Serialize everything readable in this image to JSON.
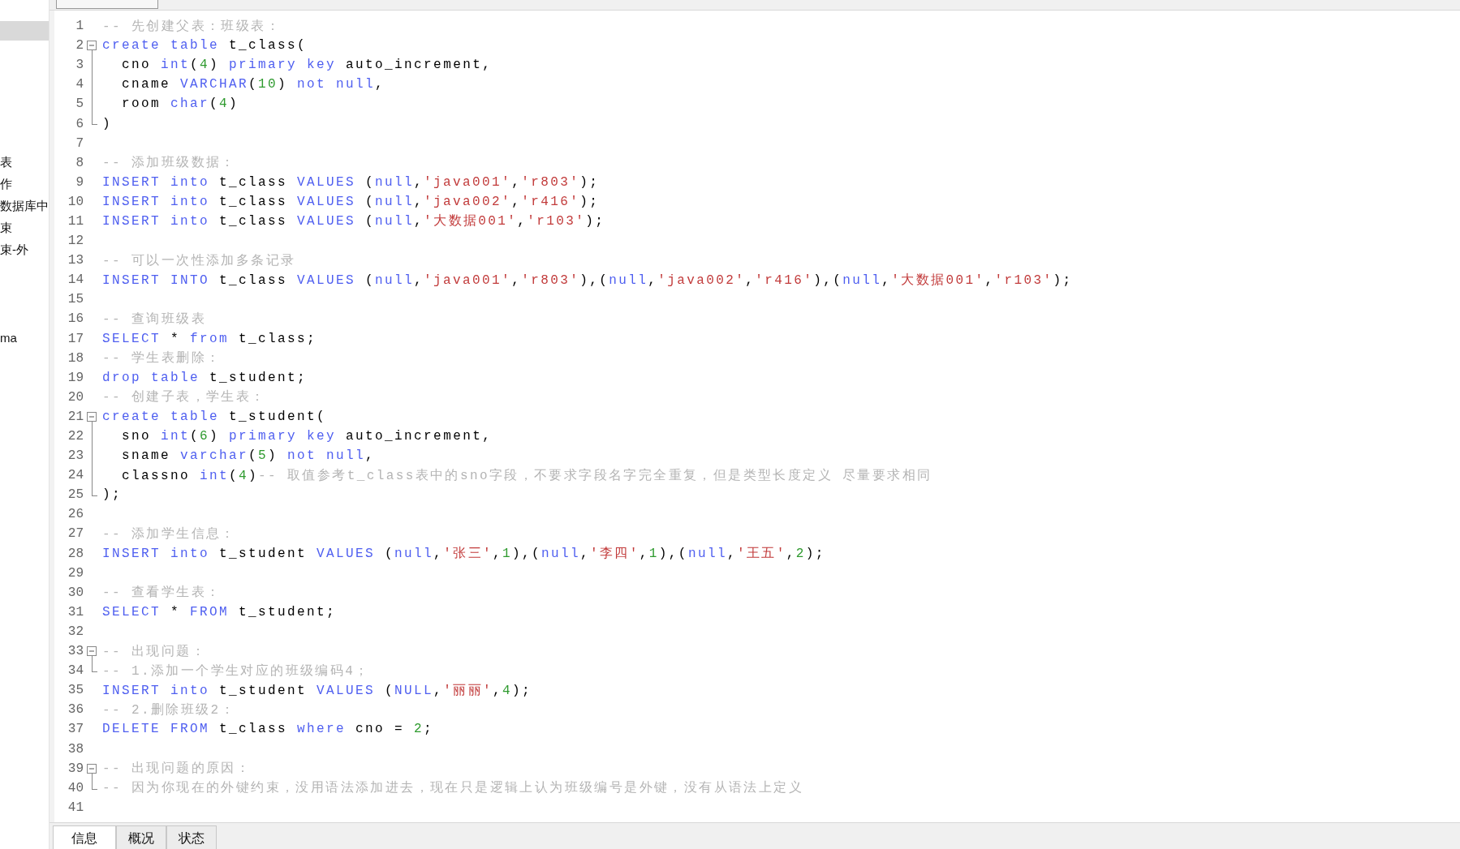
{
  "sidebar": {
    "items": [
      {
        "selected": true
      },
      {
        "label": "表",
        "selected": false
      },
      {
        "label": "作",
        "selected": false
      },
      {
        "label": "数据库中",
        "selected": false
      },
      {
        "label": "束",
        "selected": false
      },
      {
        "label": "束-外",
        "selected": false
      },
      {
        "label": "ma",
        "selected": false
      }
    ]
  },
  "editor": {
    "lines": [
      {
        "no": "1",
        "kind": "plain",
        "tokens": [
          {
            "kind": "cm",
            "t": "-- 先创建父表：班级表："
          }
        ]
      },
      {
        "no": "2",
        "kind": "fold_start",
        "tokens": [
          {
            "kind": "kw",
            "t": "create table"
          },
          {
            "kind": "tx",
            "t": " t_class("
          }
        ]
      },
      {
        "no": "3",
        "kind": "fold_mid",
        "tokens": [
          {
            "kind": "tx",
            "t": "  cno "
          },
          {
            "kind": "kw",
            "t": "int"
          },
          {
            "kind": "tx",
            "t": "("
          },
          {
            "kind": "num",
            "t": "4"
          },
          {
            "kind": "tx",
            "t": ") "
          },
          {
            "kind": "kw",
            "t": "primary key"
          },
          {
            "kind": "tx",
            "t": " auto_increment,"
          }
        ]
      },
      {
        "no": "4",
        "kind": "fold_mid",
        "tokens": [
          {
            "kind": "tx",
            "t": "  cname "
          },
          {
            "kind": "kw",
            "t": "VARCHAR"
          },
          {
            "kind": "tx",
            "t": "("
          },
          {
            "kind": "num",
            "t": "10"
          },
          {
            "kind": "tx",
            "t": ") "
          },
          {
            "kind": "kw",
            "t": "not null"
          },
          {
            "kind": "tx",
            "t": ","
          }
        ]
      },
      {
        "no": "5",
        "kind": "fold_mid",
        "tokens": [
          {
            "kind": "tx",
            "t": "  room "
          },
          {
            "kind": "kw",
            "t": "char"
          },
          {
            "kind": "tx",
            "t": "("
          },
          {
            "kind": "num",
            "t": "4"
          },
          {
            "kind": "tx",
            "t": ")"
          }
        ]
      },
      {
        "no": "6",
        "kind": "fold_end",
        "tokens": [
          {
            "kind": "tx",
            "t": ")"
          }
        ]
      },
      {
        "no": "7",
        "kind": "plain"
      },
      {
        "no": "8",
        "kind": "plain",
        "tokens": [
          {
            "kind": "cm",
            "t": "-- 添加班级数据："
          }
        ]
      },
      {
        "no": "9",
        "kind": "plain",
        "tokens": [
          {
            "kind": "kw",
            "t": "INSERT into"
          },
          {
            "kind": "tx",
            "t": " t_class "
          },
          {
            "kind": "kw",
            "t": "VALUES"
          },
          {
            "kind": "tx",
            "t": " ("
          },
          {
            "kind": "kw",
            "t": "null"
          },
          {
            "kind": "tx",
            "t": ","
          },
          {
            "kind": "str",
            "t": "'java001'"
          },
          {
            "kind": "tx",
            "t": ","
          },
          {
            "kind": "str",
            "t": "'r803'"
          },
          {
            "kind": "tx",
            "t": ");"
          }
        ]
      },
      {
        "no": "10",
        "kind": "plain",
        "tokens": [
          {
            "kind": "kw",
            "t": "INSERT into"
          },
          {
            "kind": "tx",
            "t": " t_class "
          },
          {
            "kind": "kw",
            "t": "VALUES"
          },
          {
            "kind": "tx",
            "t": " ("
          },
          {
            "kind": "kw",
            "t": "null"
          },
          {
            "kind": "tx",
            "t": ","
          },
          {
            "kind": "str",
            "t": "'java002'"
          },
          {
            "kind": "tx",
            "t": ","
          },
          {
            "kind": "str",
            "t": "'r416'"
          },
          {
            "kind": "tx",
            "t": ");"
          }
        ]
      },
      {
        "no": "11",
        "kind": "plain",
        "tokens": [
          {
            "kind": "kw",
            "t": "INSERT into"
          },
          {
            "kind": "tx",
            "t": " t_class "
          },
          {
            "kind": "kw",
            "t": "VALUES"
          },
          {
            "kind": "tx",
            "t": " ("
          },
          {
            "kind": "kw",
            "t": "null"
          },
          {
            "kind": "tx",
            "t": ","
          },
          {
            "kind": "str",
            "t": "'大数据001'"
          },
          {
            "kind": "tx",
            "t": ","
          },
          {
            "kind": "str",
            "t": "'r103'"
          },
          {
            "kind": "tx",
            "t": ");"
          }
        ]
      },
      {
        "no": "12",
        "kind": "plain"
      },
      {
        "no": "13",
        "kind": "plain",
        "tokens": [
          {
            "kind": "cm",
            "t": "-- 可以一次性添加多条记录"
          }
        ]
      },
      {
        "no": "14",
        "kind": "plain",
        "tokens": [
          {
            "kind": "kw",
            "t": "INSERT INTO"
          },
          {
            "kind": "tx",
            "t": " t_class "
          },
          {
            "kind": "kw",
            "t": "VALUES"
          },
          {
            "kind": "tx",
            "t": " ("
          },
          {
            "kind": "kw",
            "t": "null"
          },
          {
            "kind": "tx",
            "t": ","
          },
          {
            "kind": "str",
            "t": "'java001'"
          },
          {
            "kind": "tx",
            "t": ","
          },
          {
            "kind": "str",
            "t": "'r803'"
          },
          {
            "kind": "tx",
            "t": "),("
          },
          {
            "kind": "kw",
            "t": "null"
          },
          {
            "kind": "tx",
            "t": ","
          },
          {
            "kind": "str",
            "t": "'java002'"
          },
          {
            "kind": "tx",
            "t": ","
          },
          {
            "kind": "str",
            "t": "'r416'"
          },
          {
            "kind": "tx",
            "t": "),("
          },
          {
            "kind": "kw",
            "t": "null"
          },
          {
            "kind": "tx",
            "t": ","
          },
          {
            "kind": "str",
            "t": "'大数据001'"
          },
          {
            "kind": "tx",
            "t": ","
          },
          {
            "kind": "str",
            "t": "'r103'"
          },
          {
            "kind": "tx",
            "t": ");"
          }
        ]
      },
      {
        "no": "15",
        "kind": "plain"
      },
      {
        "no": "16",
        "kind": "plain",
        "tokens": [
          {
            "kind": "cm",
            "t": "-- 查询班级表"
          }
        ]
      },
      {
        "no": "17",
        "kind": "plain",
        "tokens": [
          {
            "kind": "kw",
            "t": "SELECT"
          },
          {
            "kind": "tx",
            "t": " * "
          },
          {
            "kind": "kw",
            "t": "from"
          },
          {
            "kind": "tx",
            "t": " t_class;"
          }
        ]
      },
      {
        "no": "18",
        "kind": "plain",
        "tokens": [
          {
            "kind": "cm",
            "t": "-- 学生表删除："
          }
        ]
      },
      {
        "no": "19",
        "kind": "plain",
        "tokens": [
          {
            "kind": "kw",
            "t": "drop table"
          },
          {
            "kind": "tx",
            "t": " t_student;"
          }
        ]
      },
      {
        "no": "20",
        "kind": "plain",
        "tokens": [
          {
            "kind": "cm",
            "t": "-- 创建子表，学生表："
          }
        ]
      },
      {
        "no": "21",
        "kind": "fold_start",
        "tokens": [
          {
            "kind": "kw",
            "t": "create table"
          },
          {
            "kind": "tx",
            "t": " t_student("
          }
        ]
      },
      {
        "no": "22",
        "kind": "fold_mid",
        "tokens": [
          {
            "kind": "tx",
            "t": "  sno "
          },
          {
            "kind": "kw",
            "t": "int"
          },
          {
            "kind": "tx",
            "t": "("
          },
          {
            "kind": "num",
            "t": "6"
          },
          {
            "kind": "tx",
            "t": ") "
          },
          {
            "kind": "kw",
            "t": "primary key"
          },
          {
            "kind": "tx",
            "t": " auto_increment,"
          }
        ]
      },
      {
        "no": "23",
        "kind": "fold_mid",
        "tokens": [
          {
            "kind": "tx",
            "t": "  sname "
          },
          {
            "kind": "kw",
            "t": "varchar"
          },
          {
            "kind": "tx",
            "t": "("
          },
          {
            "kind": "num",
            "t": "5"
          },
          {
            "kind": "tx",
            "t": ") "
          },
          {
            "kind": "kw",
            "t": "not null"
          },
          {
            "kind": "tx",
            "t": ","
          }
        ]
      },
      {
        "no": "24",
        "kind": "fold_mid",
        "tokens": [
          {
            "kind": "tx",
            "t": "  classno "
          },
          {
            "kind": "kw",
            "t": "int"
          },
          {
            "kind": "tx",
            "t": "("
          },
          {
            "kind": "num",
            "t": "4"
          },
          {
            "kind": "tx",
            "t": ")"
          },
          {
            "kind": "cm",
            "t": "-- 取值参考t_class表中的sno字段，不要求字段名字完全重复，但是类型长度定义 尽量要求相同"
          }
        ]
      },
      {
        "no": "25",
        "kind": "fold_end",
        "tokens": [
          {
            "kind": "tx",
            "t": ");"
          }
        ]
      },
      {
        "no": "26",
        "kind": "plain"
      },
      {
        "no": "27",
        "kind": "plain",
        "tokens": [
          {
            "kind": "cm",
            "t": "-- 添加学生信息："
          }
        ]
      },
      {
        "no": "28",
        "kind": "plain",
        "tokens": [
          {
            "kind": "kw",
            "t": "INSERT into"
          },
          {
            "kind": "tx",
            "t": " t_student "
          },
          {
            "kind": "kw",
            "t": "VALUES"
          },
          {
            "kind": "tx",
            "t": " ("
          },
          {
            "kind": "kw",
            "t": "null"
          },
          {
            "kind": "tx",
            "t": ","
          },
          {
            "kind": "str",
            "t": "'张三'"
          },
          {
            "kind": "tx",
            "t": ","
          },
          {
            "kind": "num",
            "t": "1"
          },
          {
            "kind": "tx",
            "t": "),("
          },
          {
            "kind": "kw",
            "t": "null"
          },
          {
            "kind": "tx",
            "t": ","
          },
          {
            "kind": "str",
            "t": "'李四'"
          },
          {
            "kind": "tx",
            "t": ","
          },
          {
            "kind": "num",
            "t": "1"
          },
          {
            "kind": "tx",
            "t": "),("
          },
          {
            "kind": "kw",
            "t": "null"
          },
          {
            "kind": "tx",
            "t": ","
          },
          {
            "kind": "str",
            "t": "'王五'"
          },
          {
            "kind": "tx",
            "t": ","
          },
          {
            "kind": "num",
            "t": "2"
          },
          {
            "kind": "tx",
            "t": ");"
          }
        ]
      },
      {
        "no": "29",
        "kind": "plain"
      },
      {
        "no": "30",
        "kind": "plain",
        "tokens": [
          {
            "kind": "cm",
            "t": "-- 查看学生表："
          }
        ]
      },
      {
        "no": "31",
        "kind": "plain",
        "tokens": [
          {
            "kind": "kw",
            "t": "SELECT"
          },
          {
            "kind": "tx",
            "t": " * "
          },
          {
            "kind": "kw",
            "t": "FROM"
          },
          {
            "kind": "tx",
            "t": " t_student;"
          }
        ]
      },
      {
        "no": "32",
        "kind": "plain"
      },
      {
        "no": "33",
        "kind": "fold_start",
        "tokens": [
          {
            "kind": "cm",
            "t": "-- 出现问题："
          }
        ]
      },
      {
        "no": "34",
        "kind": "fold_end",
        "tokens": [
          {
            "kind": "cm",
            "t": "-- 1.添加一个学生对应的班级编码4；"
          }
        ]
      },
      {
        "no": "35",
        "kind": "plain",
        "tokens": [
          {
            "kind": "kw",
            "t": "INSERT into"
          },
          {
            "kind": "tx",
            "t": " t_student "
          },
          {
            "kind": "kw",
            "t": "VALUES"
          },
          {
            "kind": "tx",
            "t": " ("
          },
          {
            "kind": "kw",
            "t": "NULL"
          },
          {
            "kind": "tx",
            "t": ","
          },
          {
            "kind": "str",
            "t": "'丽丽'"
          },
          {
            "kind": "tx",
            "t": ","
          },
          {
            "kind": "num",
            "t": "4"
          },
          {
            "kind": "tx",
            "t": ");"
          }
        ]
      },
      {
        "no": "36",
        "kind": "plain",
        "tokens": [
          {
            "kind": "cm",
            "t": "-- 2.删除班级2："
          }
        ]
      },
      {
        "no": "37",
        "kind": "plain",
        "tokens": [
          {
            "kind": "kw",
            "t": "DELETE FROM"
          },
          {
            "kind": "tx",
            "t": " t_class "
          },
          {
            "kind": "kw",
            "t": "where"
          },
          {
            "kind": "tx",
            "t": " cno = "
          },
          {
            "kind": "num",
            "t": "2"
          },
          {
            "kind": "tx",
            "t": ";"
          }
        ]
      },
      {
        "no": "38",
        "kind": "plain"
      },
      {
        "no": "39",
        "kind": "fold_start",
        "tokens": [
          {
            "kind": "cm",
            "t": "-- 出现问题的原因："
          }
        ]
      },
      {
        "no": "40",
        "kind": "fold_end",
        "tokens": [
          {
            "kind": "cm",
            "t": "-- 因为你现在的外键约束，没用语法添加进去，现在只是逻辑上认为班级编号是外键，没有从语法上定义"
          }
        ]
      },
      {
        "no": "41",
        "kind": "plain"
      }
    ]
  },
  "bottom_tabs": [
    {
      "label": "信息",
      "selected": true
    },
    {
      "label": "概况",
      "selected": false
    },
    {
      "label": "状态",
      "selected": false
    }
  ]
}
